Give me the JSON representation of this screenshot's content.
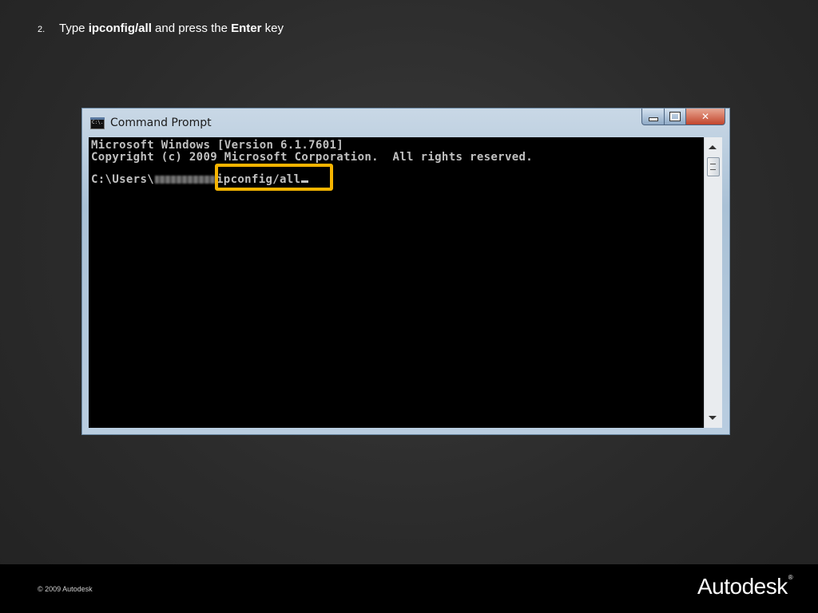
{
  "slide": {
    "step_number": "2.",
    "step_parts": [
      "Type ",
      "ipconfig/all",
      " and press the ",
      "Enter",
      " key"
    ]
  },
  "window": {
    "title": "Command Prompt",
    "icon": "cmd-icon",
    "icon_text": "C:\\."
  },
  "console": {
    "line1": "Microsoft Windows [Version 6.1.7601]",
    "line2": "Copyright (c) 2009 Microsoft Corporation.  All rights reserved.",
    "prompt_prefix": "C:\\Users\\",
    "command": "ipconfig/all"
  },
  "highlight_color": "#f5b400",
  "footer": {
    "copyright": "© 2009 Autodesk",
    "logo": "Autodesk",
    "logo_mark": "®"
  }
}
